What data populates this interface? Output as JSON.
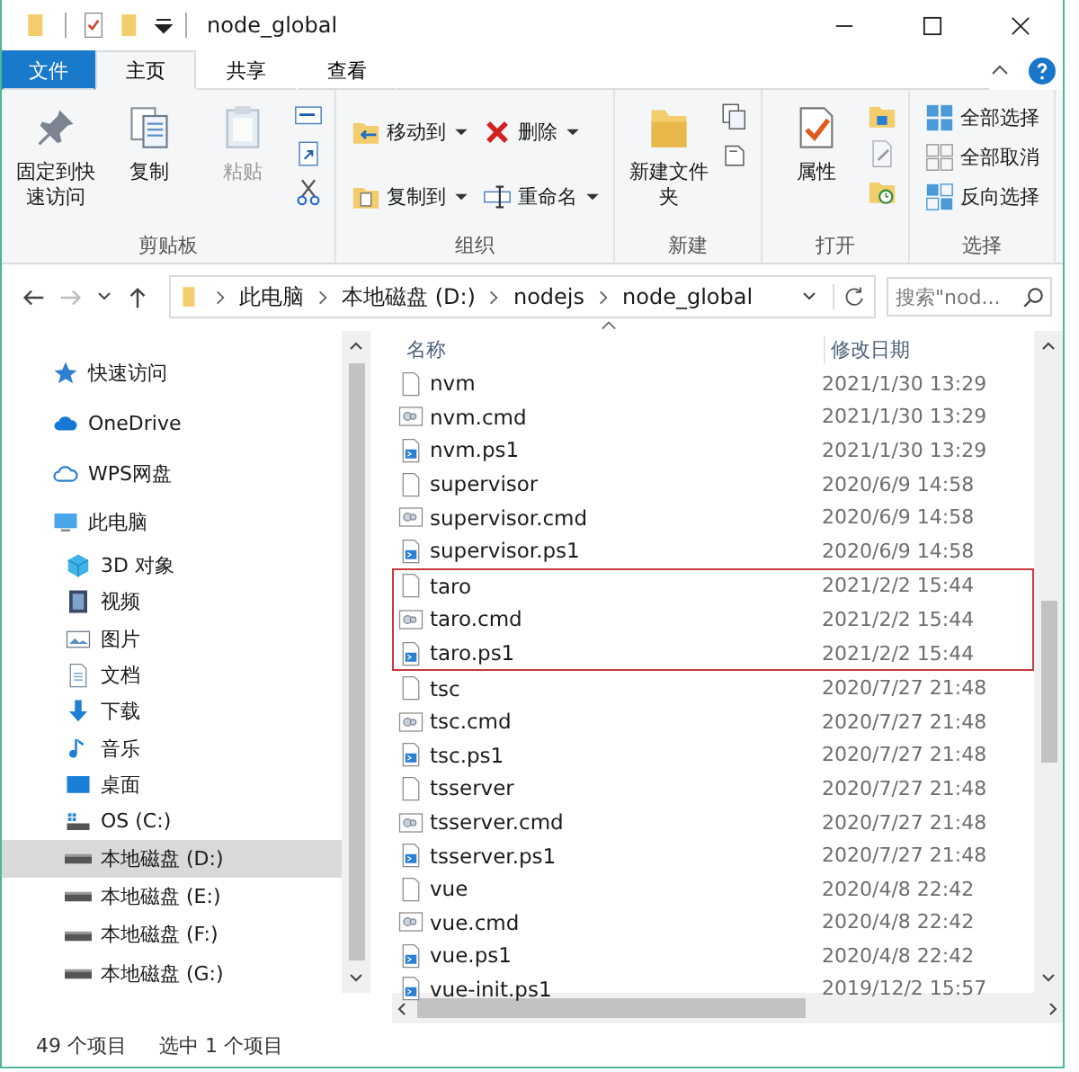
{
  "window": {
    "title": "node_global"
  },
  "ribbon_tabs": [
    {
      "label": "文件",
      "kind": "file",
      "selected": false
    },
    {
      "label": "主页",
      "kind": "tab",
      "selected": true
    },
    {
      "label": "共享",
      "kind": "tab",
      "selected": false
    },
    {
      "label": "查看",
      "kind": "tab",
      "selected": false
    }
  ],
  "ribbon_groups": [
    {
      "label": "剪贴板",
      "items": [
        {
          "kind": "large",
          "label": "固定到快速访问",
          "disabled": false
        },
        {
          "kind": "large",
          "label": "复制",
          "disabled": false
        },
        {
          "kind": "large",
          "label": "粘贴",
          "disabled": true
        },
        {
          "kind": "smallstack"
        }
      ]
    },
    {
      "label": "组织",
      "items": [
        {
          "kind": "pair",
          "buttons": [
            {
              "label": "移动到"
            },
            {
              "label": "复制到"
            }
          ]
        },
        {
          "kind": "pair",
          "buttons": [
            {
              "label": "删除"
            },
            {
              "label": "重命名"
            }
          ]
        }
      ]
    },
    {
      "label": "新建",
      "items": [
        {
          "kind": "large",
          "label": "新建文件夹",
          "disabled": false
        },
        {
          "kind": "smallstack"
        }
      ]
    },
    {
      "label": "打开",
      "items": [
        {
          "kind": "large",
          "label": "属性",
          "disabled": false
        },
        {
          "kind": "smallstack"
        }
      ]
    },
    {
      "label": "选择",
      "items": [
        {
          "kind": "list",
          "buttons": [
            {
              "label": "全部选择"
            },
            {
              "label": "全部取消"
            },
            {
              "label": "反向选择"
            }
          ]
        }
      ]
    }
  ],
  "address": {
    "crumbs": [
      "此电脑",
      "本地磁盘 (D:)",
      "nodejs",
      "node_global"
    ],
    "search_placeholder": "搜索\"nod..."
  },
  "sidebar": [
    {
      "label": "快速访问",
      "selected": false
    },
    {
      "label": "OneDrive",
      "selected": false
    },
    {
      "label": "WPS网盘",
      "selected": false
    },
    {
      "label": "此电脑",
      "selected": false,
      "children": [
        {
          "label": "3D 对象",
          "selected": false
        },
        {
          "label": "视频",
          "selected": false
        },
        {
          "label": "图片",
          "selected": false
        },
        {
          "label": "文档",
          "selected": false
        },
        {
          "label": "下载",
          "selected": false
        },
        {
          "label": "音乐",
          "selected": false
        },
        {
          "label": "桌面",
          "selected": false
        },
        {
          "label": "OS (C:)",
          "selected": false
        },
        {
          "label": "本地磁盘 (D:)",
          "selected": true
        },
        {
          "label": "本地磁盘 (E:)",
          "selected": false
        },
        {
          "label": "本地磁盘 (F:)",
          "selected": false
        },
        {
          "label": "本地磁盘 (G:)",
          "selected": false
        }
      ]
    }
  ],
  "columns": [
    "名称",
    "修改日期"
  ],
  "files": [
    {
      "name": "nvm",
      "kind": "file",
      "date": "2021/1/30 13:29",
      "highlighted": false
    },
    {
      "name": "nvm.cmd",
      "kind": "cmd",
      "date": "2021/1/30 13:29",
      "highlighted": false
    },
    {
      "name": "nvm.ps1",
      "kind": "ps1",
      "date": "2021/1/30 13:29",
      "highlighted": false
    },
    {
      "name": "supervisor",
      "kind": "file",
      "date": "2020/6/9 14:58",
      "highlighted": false
    },
    {
      "name": "supervisor.cmd",
      "kind": "cmd",
      "date": "2020/6/9 14:58",
      "highlighted": false
    },
    {
      "name": "supervisor.ps1",
      "kind": "ps1",
      "date": "2020/6/9 14:58",
      "highlighted": false
    },
    {
      "name": "taro",
      "kind": "file",
      "date": "2021/2/2 15:44",
      "highlighted": true
    },
    {
      "name": "taro.cmd",
      "kind": "cmd",
      "date": "2021/2/2 15:44",
      "highlighted": true
    },
    {
      "name": "taro.ps1",
      "kind": "ps1",
      "date": "2021/2/2 15:44",
      "highlighted": true
    },
    {
      "name": "tsc",
      "kind": "file",
      "date": "2020/7/27 21:48",
      "highlighted": false
    },
    {
      "name": "tsc.cmd",
      "kind": "cmd",
      "date": "2020/7/27 21:48",
      "highlighted": false
    },
    {
      "name": "tsc.ps1",
      "kind": "ps1",
      "date": "2020/7/27 21:48",
      "highlighted": false
    },
    {
      "name": "tsserver",
      "kind": "file",
      "date": "2020/7/27 21:48",
      "highlighted": false
    },
    {
      "name": "tsserver.cmd",
      "kind": "cmd",
      "date": "2020/7/27 21:48",
      "highlighted": false
    },
    {
      "name": "tsserver.ps1",
      "kind": "ps1",
      "date": "2020/7/27 21:48",
      "highlighted": false
    },
    {
      "name": "vue",
      "kind": "file",
      "date": "2020/4/8 22:42",
      "highlighted": false
    },
    {
      "name": "vue.cmd",
      "kind": "cmd",
      "date": "2020/4/8 22:42",
      "highlighted": false
    },
    {
      "name": "vue.ps1",
      "kind": "ps1",
      "date": "2020/4/8 22:42",
      "highlighted": false
    },
    {
      "name": "vue-init.ps1",
      "kind": "ps1",
      "date": "2019/12/2 15:57",
      "highlighted": false
    }
  ],
  "status_bar": {
    "count": "49 个项目",
    "selection": "选中 1 个项目"
  }
}
